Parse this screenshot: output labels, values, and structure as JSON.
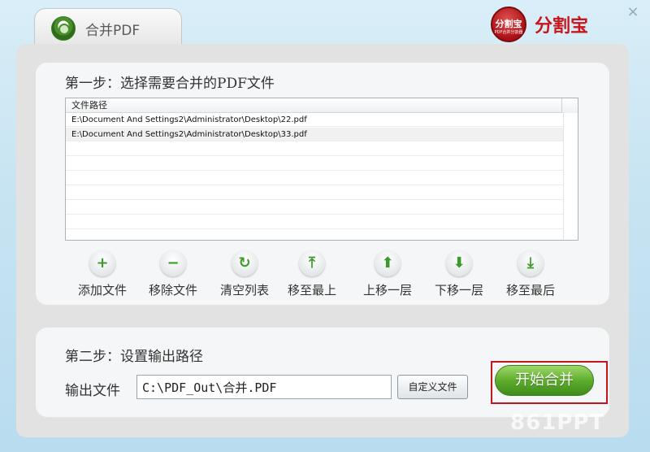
{
  "header": {
    "tab_label": "合并PDF",
    "brand_logo_text": "分割宝",
    "brand_logo_sub": "PDF合并分割器",
    "brand_name": "分割宝",
    "close_glyph": "×"
  },
  "step1": {
    "title": "第一步：选择需要合并的PDF文件",
    "column_header": "文件路径",
    "files": [
      "E:\\Document And Settings2\\Administrator\\Desktop\\22.pdf",
      "E:\\Document And Settings2\\Administrator\\Desktop\\33.pdf"
    ]
  },
  "toolbar": [
    {
      "label": "添加文件",
      "icon": "plus-icon",
      "glyph": "+"
    },
    {
      "label": "移除文件",
      "icon": "minus-icon",
      "glyph": "−"
    },
    {
      "label": "清空列表",
      "icon": "refresh-icon",
      "glyph": "↻"
    },
    {
      "label": "移至最上",
      "icon": "move-top-icon",
      "glyph": "⤒"
    },
    {
      "label": "上移一层",
      "icon": "arrow-up-icon",
      "glyph": "⬆"
    },
    {
      "label": "下移一层",
      "icon": "arrow-down-icon",
      "glyph": "⬇"
    },
    {
      "label": "移至最后",
      "icon": "move-bottom-icon",
      "glyph": "⤓"
    }
  ],
  "step2": {
    "title": "第二步：设置输出路径",
    "output_label": "输出文件",
    "output_value": "C:\\PDF_Out\\合并.PDF",
    "custom_button": "自定义文件",
    "start_button": "开始合并"
  },
  "watermark": "861PPT",
  "colors": {
    "accent_green": "#5eae2d",
    "brand_red": "#c8151b",
    "highlight_frame": "#c4161c"
  }
}
